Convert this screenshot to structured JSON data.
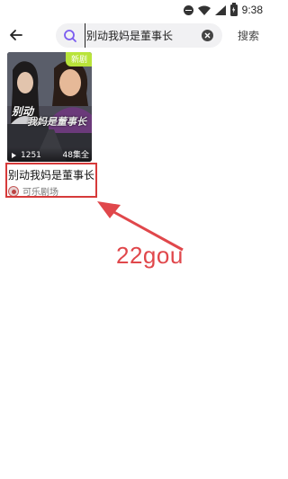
{
  "status_bar": {
    "time": "9:38"
  },
  "search": {
    "query": "别动我妈是董事长",
    "submit_label": "搜索"
  },
  "result": {
    "badge": "新剧",
    "poster_title_line1": "别动",
    "poster_title_line2": "我妈是董事长",
    "play_count": "1251",
    "episodes": "48集全",
    "title": "别动我妈是董事长",
    "channel": "可乐剧场"
  },
  "annotation": {
    "text": "22gou",
    "color": "#e0474b"
  },
  "colors": {
    "badge": "#b9e43a",
    "highlight": "#d63a3a",
    "search_icon": "#7b5cf0"
  }
}
